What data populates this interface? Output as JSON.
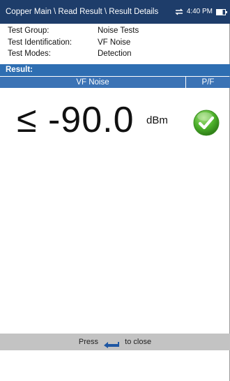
{
  "titlebar": {
    "breadcrumb": "Copper Main \\ Read Result \\ Result Details",
    "time": "4:40 PM"
  },
  "info": {
    "rows": [
      {
        "label": "Test Group:",
        "value": "Noise Tests"
      },
      {
        "label": "Test Identification:",
        "value": "VF Noise"
      },
      {
        "label": "Test Modes:",
        "value": "Detection"
      }
    ]
  },
  "result": {
    "header": "Result:",
    "columns": [
      "VF Noise",
      "P/F"
    ],
    "value": "≤ -90.0",
    "unit": "dBm",
    "status": "pass"
  },
  "footer": {
    "prefix": "Press",
    "suffix": "to close"
  },
  "colors": {
    "titlebar": "#1e3d6a",
    "accent": "#2e6eb2",
    "pass": "#4cb02a",
    "footer": "#c3c3c3"
  },
  "icons": [
    "sync-icon",
    "battery-icon",
    "checkmark-pass-icon",
    "back-arrow-icon"
  ]
}
